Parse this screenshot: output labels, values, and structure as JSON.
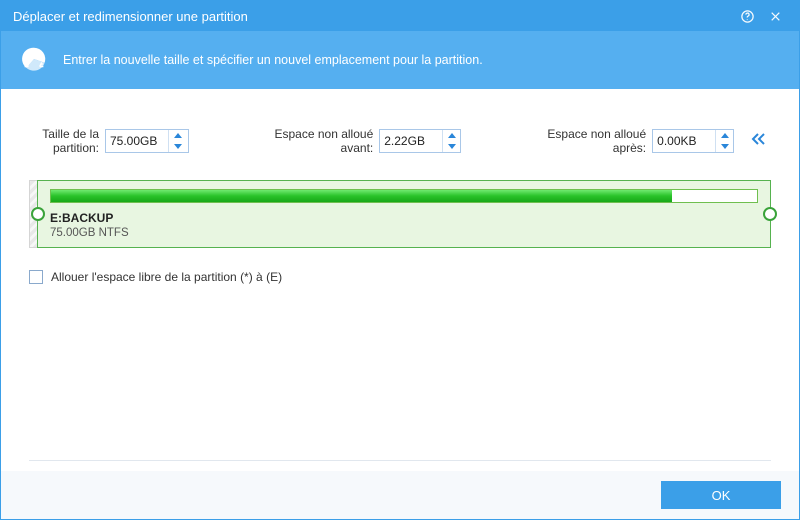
{
  "window": {
    "title": "Déplacer et redimensionner une partition"
  },
  "banner": {
    "text": "Entrer la nouvelle taille et spécifier un nouvel emplacement pour la partition."
  },
  "fields": {
    "partition_size": {
      "label": "Taille de la partition:",
      "value": "75.00GB"
    },
    "unallocated_before": {
      "label": "Espace non alloué avant:",
      "value": "2.22GB"
    },
    "unallocated_after": {
      "label": "Espace non alloué après:",
      "value": "0.00KB"
    }
  },
  "partition": {
    "name": "E:BACKUP",
    "meta": "75.00GB NTFS",
    "used_percent": 88
  },
  "checkbox": {
    "label": "Allouer l'espace libre de la partition (*) à (E)",
    "checked": false
  },
  "buttons": {
    "ok": "OK"
  }
}
